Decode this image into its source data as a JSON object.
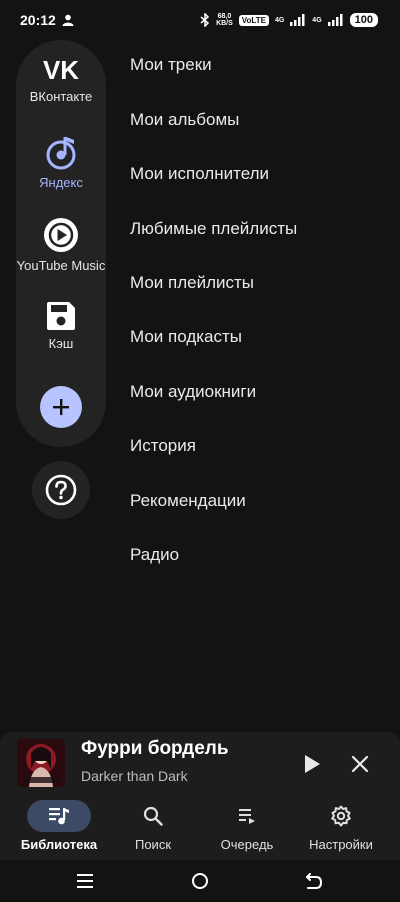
{
  "status_bar": {
    "time": "20:12",
    "net_speed_value": "68,0",
    "net_speed_unit": "KB/S",
    "volte": "VoLTE",
    "sim1_type": "4G",
    "sim2_type": "4G",
    "battery": "100"
  },
  "sidebar": {
    "items": [
      {
        "label": "ВКонтакте",
        "icon": "vk-logo-icon",
        "selected": false
      },
      {
        "label": "Яндекс",
        "icon": "music-note-icon",
        "selected": true
      },
      {
        "label": "YouTube Music",
        "icon": "youtube-music-icon",
        "selected": false
      },
      {
        "label": "Кэш",
        "icon": "save-icon",
        "selected": false
      }
    ],
    "add_icon": "plus-icon",
    "help_icon": "help-icon"
  },
  "menu": {
    "items": [
      "Мои треки",
      "Мои альбомы",
      "Мои исполнители",
      "Любимые плейлисты",
      "Мои плейлисты",
      "Мои подкасты",
      "Мои аудиокниги",
      "История",
      "Рекомендации",
      "Радио"
    ]
  },
  "player": {
    "title": "Фурри бордель",
    "artist": "Darker than Dark"
  },
  "bottom_nav": {
    "items": [
      {
        "label": "Библиотека",
        "icon": "library-music-icon",
        "active": true
      },
      {
        "label": "Поиск",
        "icon": "search-icon",
        "active": false
      },
      {
        "label": "Очередь",
        "icon": "queue-icon",
        "active": false
      },
      {
        "label": "Настройки",
        "icon": "settings-gear-icon",
        "active": false
      }
    ]
  },
  "colors": {
    "background": "#131313",
    "rail": "#232323",
    "accent": "#b7c4ff",
    "selected_label": "#a6b5ff",
    "active_pill": "#3d4a66"
  }
}
